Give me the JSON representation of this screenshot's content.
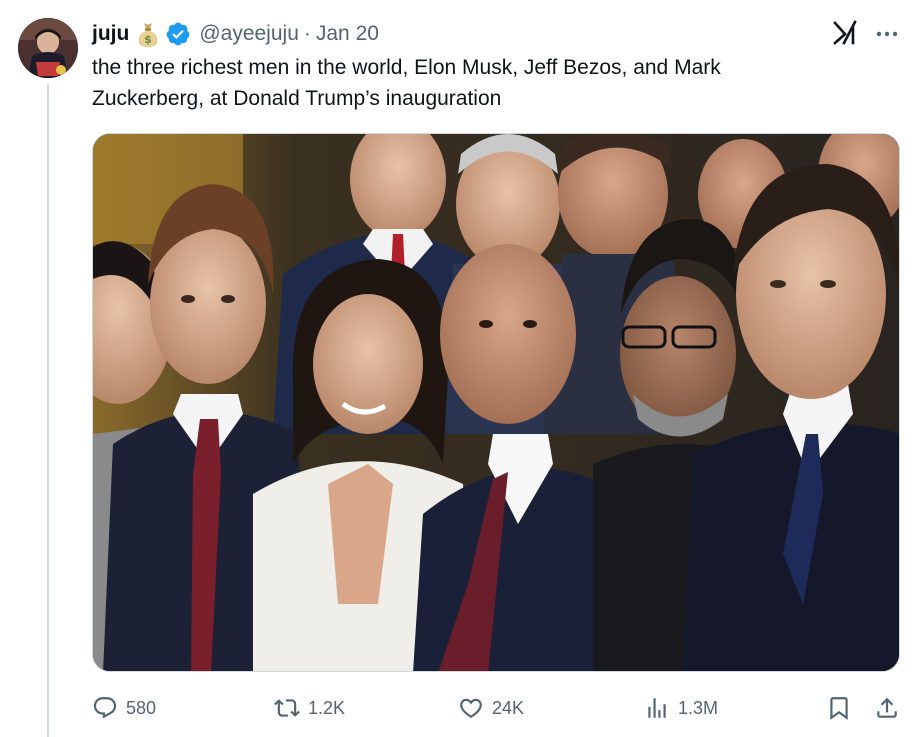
{
  "author": {
    "display_name": "juju",
    "name_emoji": "money-bag-emoji",
    "verified_badge": "verified-check-icon",
    "handle": "@ayeejuju",
    "separator": "·",
    "date": "Jan 20"
  },
  "tweet": {
    "text": "the three richest men in the world, Elon Musk, Jeff Bezos, and Mark\nZuckerberg, at Donald Trump’s inauguration"
  },
  "header_icons": {
    "grok": "grok-icon",
    "more": "more-icon"
  },
  "media": {
    "type": "photo"
  },
  "actions": {
    "replies": "580",
    "reposts": "1.2K",
    "likes": "24K",
    "views": "1.3M",
    "bookmark": "bookmark-icon",
    "share": "share-icon"
  },
  "colors": {
    "text_primary": "#0f1419",
    "text_secondary": "#536471",
    "verified_blue": "#1d9bf0",
    "border": "#cfd9de"
  }
}
